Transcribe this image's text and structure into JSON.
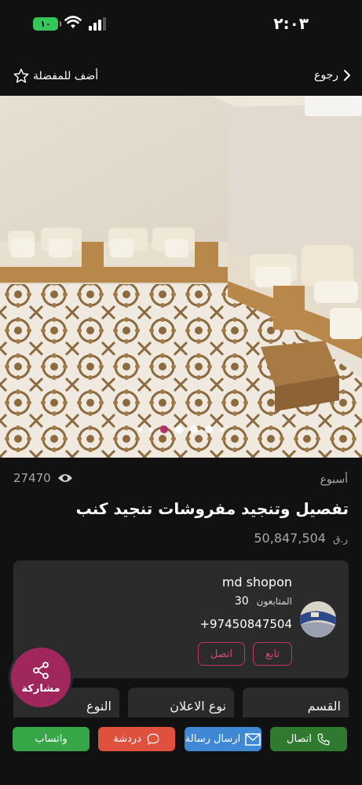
{
  "status_bar": {
    "time": "٢:٠٣",
    "battery": "١٠"
  },
  "nav": {
    "back_label": "رجوع",
    "favorite_label": "أضف للمفضلة"
  },
  "listing": {
    "views": "27470",
    "age": "أسبوع",
    "title": "تفصيل وتنجيد مفروشات تنجيد كنب",
    "price": "50,847,504",
    "currency": "ر.ق",
    "image_count": 7,
    "active_image_index": 2
  },
  "seller": {
    "name": "md shopon",
    "followers_label": "المتابعون",
    "followers_count": "30",
    "phone": "+97450847504",
    "follow_label": "تابع",
    "call_label": "اتصل"
  },
  "info_cards": [
    {
      "label": "القسم"
    },
    {
      "label": "نوع الاعلان"
    },
    {
      "label": "النوع"
    }
  ],
  "share": {
    "label": "مشاركة"
  },
  "actions": {
    "call": "اتصال",
    "message": "ارسال رسالة",
    "chat": "دردشة",
    "whatsapp": "واتساب"
  },
  "colors": {
    "accent": "#b02a6a",
    "call": "#2f7a2e",
    "message": "#3e88d6",
    "chat": "#e0513d",
    "whatsapp": "#36a646",
    "card": "#2b2b2b",
    "background": "#111111"
  }
}
